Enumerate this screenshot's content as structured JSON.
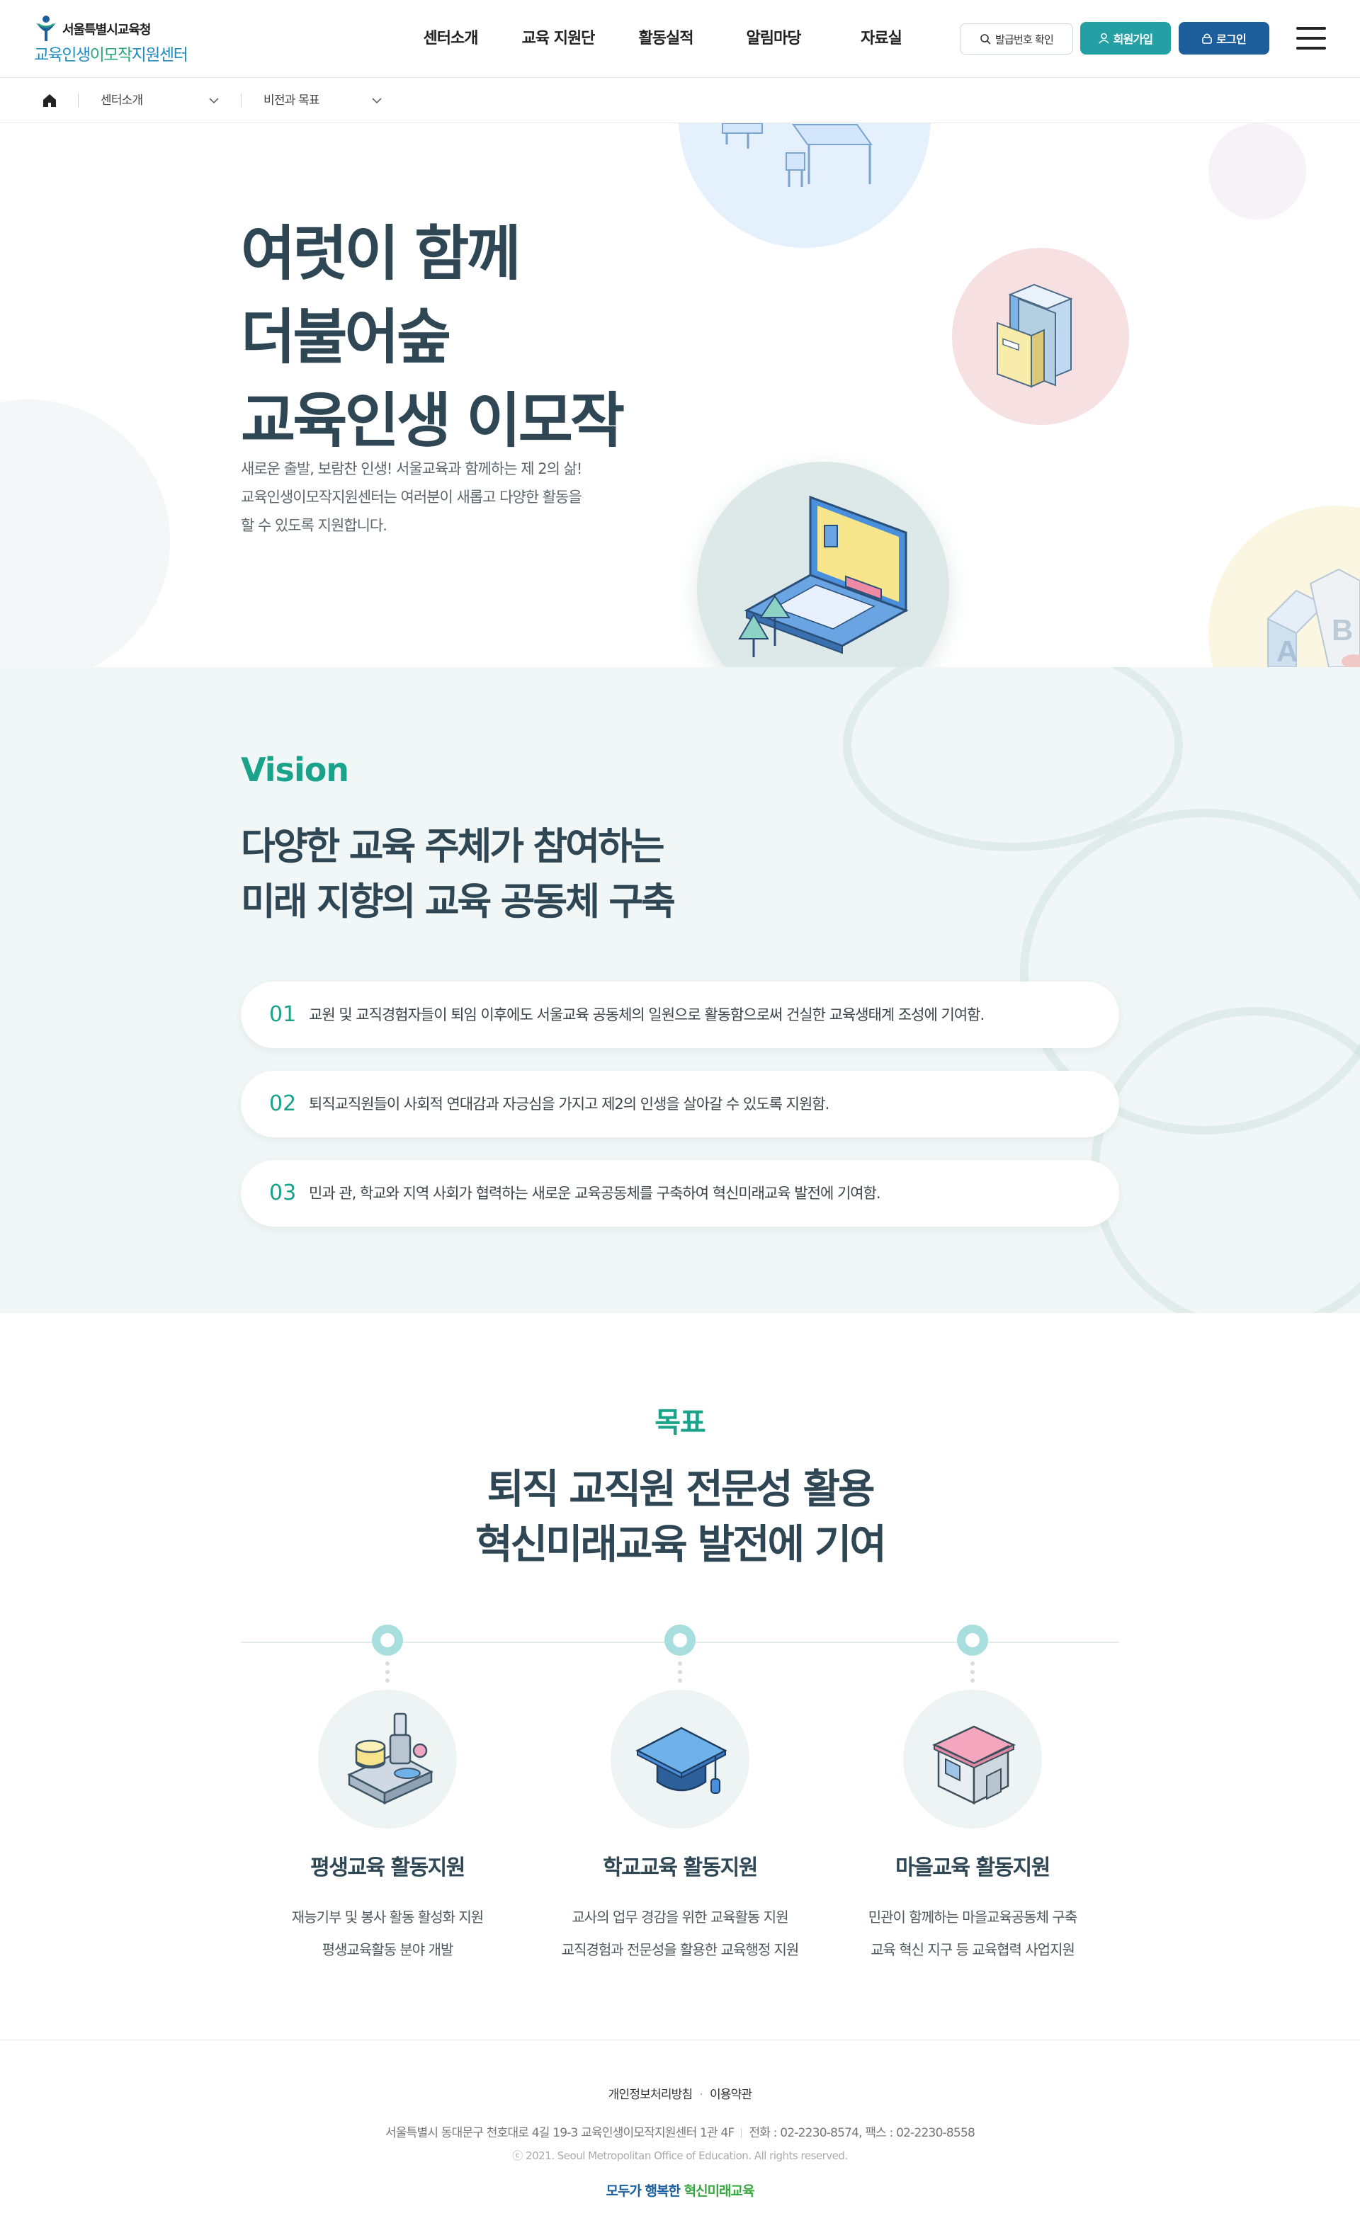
{
  "header": {
    "logo_top": "서울특별시교육청",
    "logo_bottom_1": "교육인생",
    "logo_bottom_2": "이모작",
    "logo_bottom_3": "지원센터",
    "nav": [
      "센터소개",
      "교육 지원단",
      "활동실적",
      "알림마당",
      "자료실"
    ],
    "cert_button": "발급번호 확인",
    "join_button": "회원가입",
    "login_button": "로그인"
  },
  "breadcrumb": {
    "level1": "센터소개",
    "level2": "비전과 목표"
  },
  "hero": {
    "title_lines": [
      "여럿이 함께",
      "더불어숲",
      "교육인생 이모작"
    ],
    "desc_lines": [
      "새로운 출발, 보람찬 인생! 서울교육과 함께하는 제 2의 삶!",
      "교육인생이모작지원센터는 여러분이 새롭고 다양한 활동을",
      "할 수 있도록 지원합니다."
    ]
  },
  "vision": {
    "label": "Vision",
    "title_lines": [
      "다양한 교육 주체가 참여하는",
      "미래 지향의 교육 공동체 구축"
    ],
    "items": [
      {
        "num": "01",
        "text": "교원 및 교직경험자들이 퇴임 이후에도 서울교육 공동체의 일원으로 활동함으로써 건실한 교육생태계 조성에 기여함."
      },
      {
        "num": "02",
        "text": "퇴직교직원들이 사회적 연대감과 자긍심을 가지고 제2의 인생을 살아갈 수 있도록 지원함."
      },
      {
        "num": "03",
        "text": "민과 관, 학교와 지역 사회가 협력하는 새로운 교육공동체를 구축하여 혁신미래교육 발전에 기여함."
      }
    ]
  },
  "goals": {
    "label": "목표",
    "title_lines": [
      "퇴직 교직원 전문성 활용",
      "혁신미래교육 발전에 기여"
    ],
    "items": [
      {
        "title": "평생교육 활동지원",
        "desc": [
          "재능기부 및 봉사 활동 활성화 지원",
          "평생교육활동 분야 개발"
        ],
        "icon": "lab-equipment-icon"
      },
      {
        "title": "학교교육 활동지원",
        "desc": [
          "교사의 업무 경감을 위한 교육활동 지원",
          "교직경험과 전문성을 활용한 교육행정 지원"
        ],
        "icon": "graduation-cap-icon"
      },
      {
        "title": "마을교육 활동지원",
        "desc": [
          "민관이 함께하는 마을교육공동체 구축",
          "교육 혁신 지구 등 교육협력 사업지원"
        ],
        "icon": "village-house-icon"
      }
    ]
  },
  "footer": {
    "privacy": "개인정보처리방침",
    "terms": "이용약관",
    "address": "서울특별시 동대문구 천호대로 4길 19-3 교육인생이모작지원센터 1관 4F",
    "contact": "전화 : 02-2230-8574, 팩스 : 02-2230-8558",
    "copyright": "ⓒ 2021. Seoul Metropolitan Office of Education. All rights reserved.",
    "slogan_a": "모두가 행복한",
    "slogan_b": "혁신미래교육"
  },
  "colors": {
    "primary_teal": "#24a0a4",
    "primary_navy": "#1d5f9c",
    "accent_green": "#1aa38a",
    "heading": "#2f4754",
    "vision_bg": "#f1f7f6"
  }
}
